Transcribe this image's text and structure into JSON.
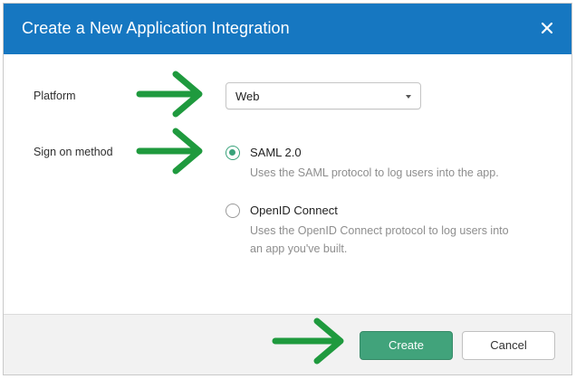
{
  "dialog": {
    "title": "Create a New Application Integration",
    "close_icon": "close-icon"
  },
  "platform": {
    "label": "Platform",
    "selected": "Web"
  },
  "sign_on": {
    "label": "Sign on method",
    "options": [
      {
        "title": "SAML 2.0",
        "description_lines": [
          "Uses the SAML protocol to log users into the app."
        ],
        "selected": true
      },
      {
        "title": "OpenID Connect",
        "description_lines": [
          "Uses the OpenID Connect protocol to log users into",
          "an app you've built."
        ],
        "selected": false
      }
    ]
  },
  "footer": {
    "create_label": "Create",
    "cancel_label": "Cancel"
  },
  "colors": {
    "header": "#1677c1",
    "primary_button": "#41a37b",
    "annotation_arrow": "#1f9a3e"
  }
}
